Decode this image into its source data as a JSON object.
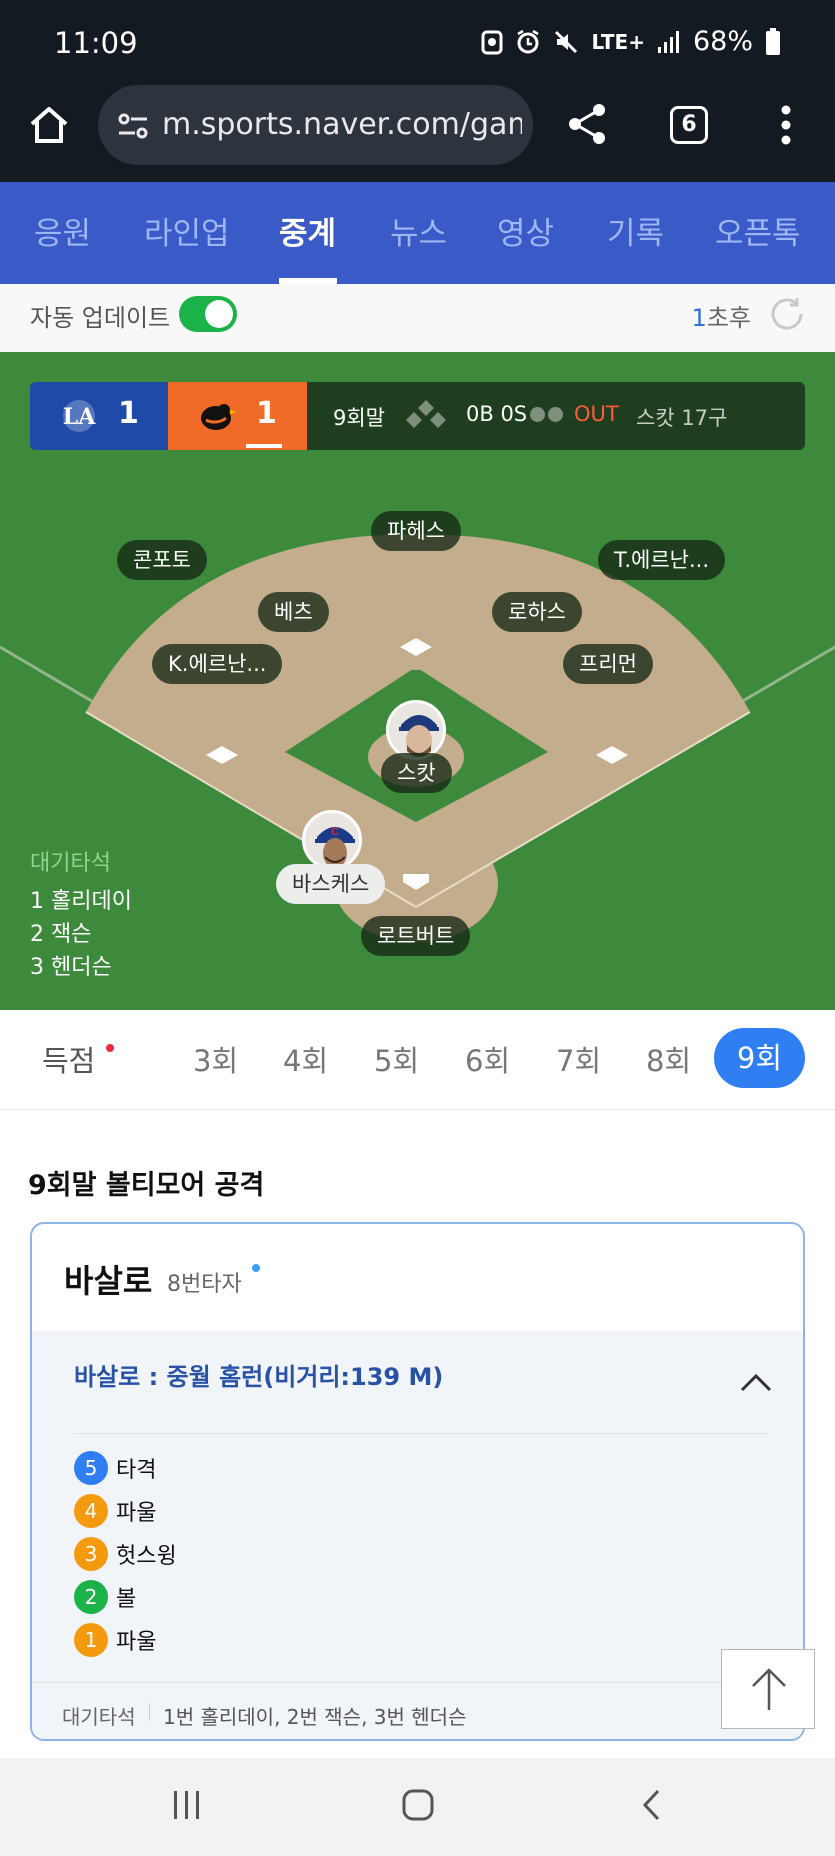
{
  "status_bar": {
    "time": "11:09",
    "network": "LTE+",
    "battery": "68%"
  },
  "browser": {
    "url": "m.sports.naver.com/game/",
    "tab_count": "6"
  },
  "nav": {
    "tabs": [
      "응원",
      "라인업",
      "중계",
      "뉴스",
      "영상",
      "기록",
      "오픈톡"
    ],
    "active": "중계"
  },
  "auto_update": {
    "label": "자동 업데이트",
    "enabled": true,
    "refresh_num": "1",
    "refresh_suffix": "초후"
  },
  "scoreboard": {
    "away_score": "1",
    "home_score": "1",
    "inning": "9회말",
    "count": "0B 0S",
    "out_label": "OUT",
    "pitcher_pitch_count": "스캇 17구",
    "colors": {
      "away": "#1f4aa8",
      "home": "#f06a28"
    }
  },
  "field": {
    "players": {
      "cf": "파헤스",
      "lf": "콘포토",
      "rf": "T.에르난...",
      "ss": "베츠",
      "2b": "로하스",
      "3b": "K.에르난...",
      "1b": "프리먼",
      "pitcher": "스캇",
      "catcher": "로트버트",
      "batter": "바스케스"
    },
    "waiting_title": "대기타석",
    "waiting": [
      "1 홀리데이",
      "2 잭슨",
      "3 헨더슨"
    ]
  },
  "innings": {
    "first": "득점",
    "tabs": [
      "3회",
      "4회",
      "5회",
      "6회",
      "7회",
      "8회"
    ],
    "active": "9회"
  },
  "play": {
    "section_title": "9회말 볼티모어 공격",
    "batter_name": "바살로",
    "batter_order": "8번타자",
    "result": "바살로 : 중월 홈런(비거리:139 M)",
    "pitches": [
      {
        "num": "5",
        "label": "타격",
        "color": "#2f7ef2"
      },
      {
        "num": "4",
        "label": "파울",
        "color": "#f59a0f"
      },
      {
        "num": "3",
        "label": "헛스윙",
        "color": "#f59a0f"
      },
      {
        "num": "2",
        "label": "볼",
        "color": "#1cb24a"
      },
      {
        "num": "1",
        "label": "파울",
        "color": "#f59a0f"
      }
    ],
    "footer_label": "대기타석",
    "footer_text": "1번 홀리데이, 2번 잭슨, 3번 헨더슨"
  }
}
